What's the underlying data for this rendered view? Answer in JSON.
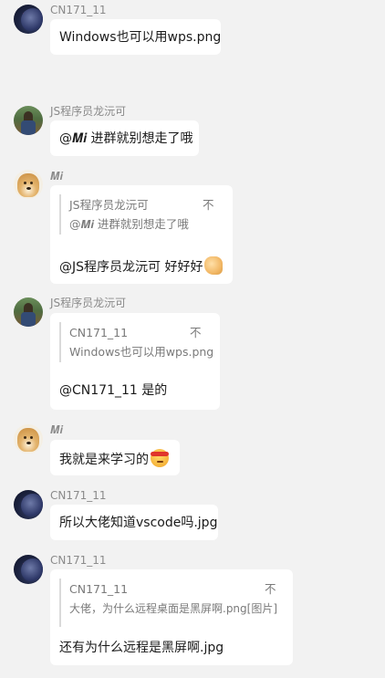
{
  "messages": [
    {
      "sender": "CN171_11",
      "avatar": "cn-avatar",
      "text": "Windows也可以用wps.png"
    },
    {
      "sender": "JS程序员龙沅可",
      "avatar": "js-avatar",
      "text": "@𝑴𝒊 进群就别想走了哦"
    },
    {
      "sender": "𝑴𝒊",
      "avatar": "doge-avatar",
      "quote": {
        "name": "JS程序员龙沅可",
        "text": "@𝑴𝒊 进群就别想走了哦",
        "mark": "不"
      },
      "text": "@JS程序员龙沅可 好好好",
      "emoji": "thumbs-up-emoji"
    },
    {
      "sender": "JS程序员龙沅可",
      "avatar": "js-avatar",
      "quote": {
        "name": "CN171_11",
        "text": "Windows也可以用wps.png",
        "mark": "不"
      },
      "text": "@CN171_11 是的"
    },
    {
      "sender": "𝑴𝒊",
      "avatar": "doge-avatar",
      "text": "我就是来学习的",
      "emoji": "headband-face-emoji"
    },
    {
      "sender": "CN171_11",
      "avatar": "cn-avatar",
      "text": "所以大佬知道vscode吗.jpg"
    },
    {
      "sender": "CN171_11",
      "avatar": "cn-avatar",
      "quote": {
        "name": "CN171_11",
        "text": "大佬，为什么远程桌面是黑屏啊.png[图片]",
        "mark": "不"
      },
      "text": "还有为什么远程是黑屏啊.jpg"
    }
  ]
}
